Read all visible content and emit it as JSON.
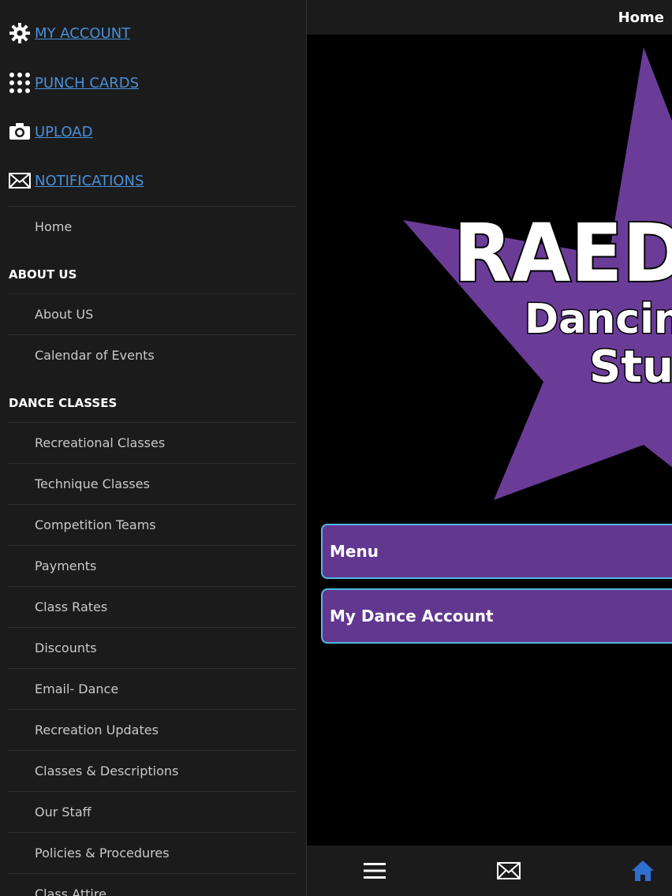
{
  "sidebar": {
    "top_links": [
      {
        "label": "MY ACCOUNT",
        "icon": "gear-icon"
      },
      {
        "label": "PUNCH CARDS",
        "icon": "grid-dots-icon"
      },
      {
        "label": "UPLOAD",
        "icon": "camera-icon"
      },
      {
        "label": "NOTIFICATIONS",
        "icon": "envelope-icon"
      }
    ],
    "home": "Home",
    "sections": [
      {
        "title": "ABOUT US",
        "items": [
          "About US",
          "Calendar of Events"
        ]
      },
      {
        "title": "DANCE CLASSES",
        "items": [
          "Recreational Classes",
          "Technique Classes",
          "Competition Teams",
          "Payments",
          "Class Rates",
          "Discounts",
          "Email- Dance",
          "Recreation Updates",
          "Classes & Descriptions",
          "Our Staff",
          "Policies & Procedures",
          "Class Attire"
        ]
      }
    ]
  },
  "header": {
    "title": "Home"
  },
  "logo": {
    "line1": "RAEDI",
    "line2": "Dancin’ S",
    "line3": "Stud",
    "star_color": "#6a3c98"
  },
  "buttons": {
    "menu": "Menu",
    "account": "My Dance Account"
  },
  "bottom_nav": {
    "icons": [
      "menu-icon",
      "envelope-icon",
      "home-icon"
    ],
    "active": "home-icon",
    "active_color": "#2f6fd0"
  }
}
